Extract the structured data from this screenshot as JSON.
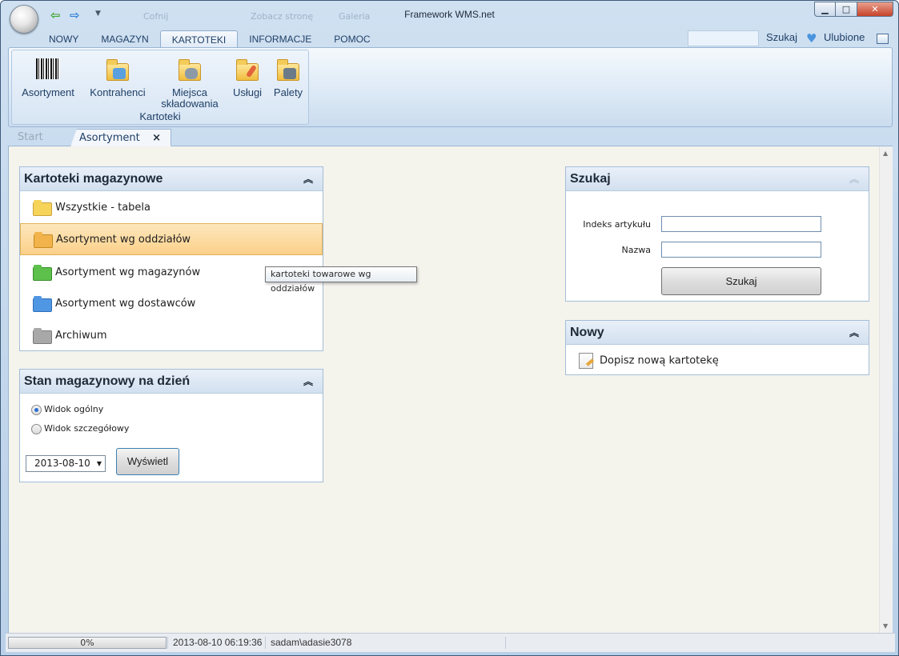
{
  "window": {
    "title": "Framework WMS.net"
  },
  "quick_access": {
    "ghost_items": [
      "Cofnij",
      "Zobacz stronę",
      "Galeria"
    ]
  },
  "ribbon": {
    "tabs": [
      "NOWY",
      "MAGAZYN",
      "KARTOTEKI",
      "INFORMACJE",
      "POMOC"
    ],
    "active_tab": "KARTOTEKI",
    "search_link": "Szukaj",
    "favorites_link": "Ulubione",
    "group": {
      "label": "Kartoteki",
      "buttons": [
        {
          "label": "Asortyment",
          "icon": "barcode-icon"
        },
        {
          "label": "Kontrahenci",
          "icon": "folder-users-icon"
        },
        {
          "label": "Miejsca",
          "label2": "składowania",
          "icon": "folder-database-icon"
        },
        {
          "label": "Usługi",
          "icon": "folder-pencil-icon"
        },
        {
          "label": "Palety",
          "icon": "folder-pallet-icon"
        }
      ]
    }
  },
  "doc_tabs": {
    "start": "Start",
    "active": "Asortyment",
    "close": "×"
  },
  "kartoteki_panel": {
    "title": "Kartoteki magazynowe",
    "items": [
      {
        "label": "Wszystkie - tabela",
        "color": "#f6d45a"
      },
      {
        "label": "Asortyment wg oddziałów",
        "color": "#f2b44a"
      },
      {
        "label": "Asortyment wg magazynów",
        "color": "#5cc04a"
      },
      {
        "label": "Asortyment wg dostawców",
        "color": "#4f96e3"
      },
      {
        "label": "Archiwum",
        "color": "#a8a8a8"
      }
    ],
    "selected_index": 1,
    "tooltip": "kartoteki towarowe wg oddziałów"
  },
  "stan_panel": {
    "title": "Stan magazynowy na dzień",
    "radio_general": "Widok ogólny",
    "radio_detail": "Widok szczegółowy",
    "selected": "general",
    "date": "2013-08-10",
    "show_button": "Wyświetl"
  },
  "szukaj_panel": {
    "title": "Szukaj",
    "index_label": "Indeks artykułu",
    "index_value": "",
    "name_label": "Nazwa",
    "name_value": "",
    "button": "Szukaj"
  },
  "nowy_panel": {
    "title": "Nowy",
    "item": "Dopisz nową kartotekę"
  },
  "status": {
    "progress": "0%",
    "progress_value": 0,
    "datetime": "2013-08-10 06:19:36",
    "user": "sadam\\adasie3078"
  },
  "colors": {
    "accent": "#1f3f66",
    "selection": "#fbd089"
  }
}
